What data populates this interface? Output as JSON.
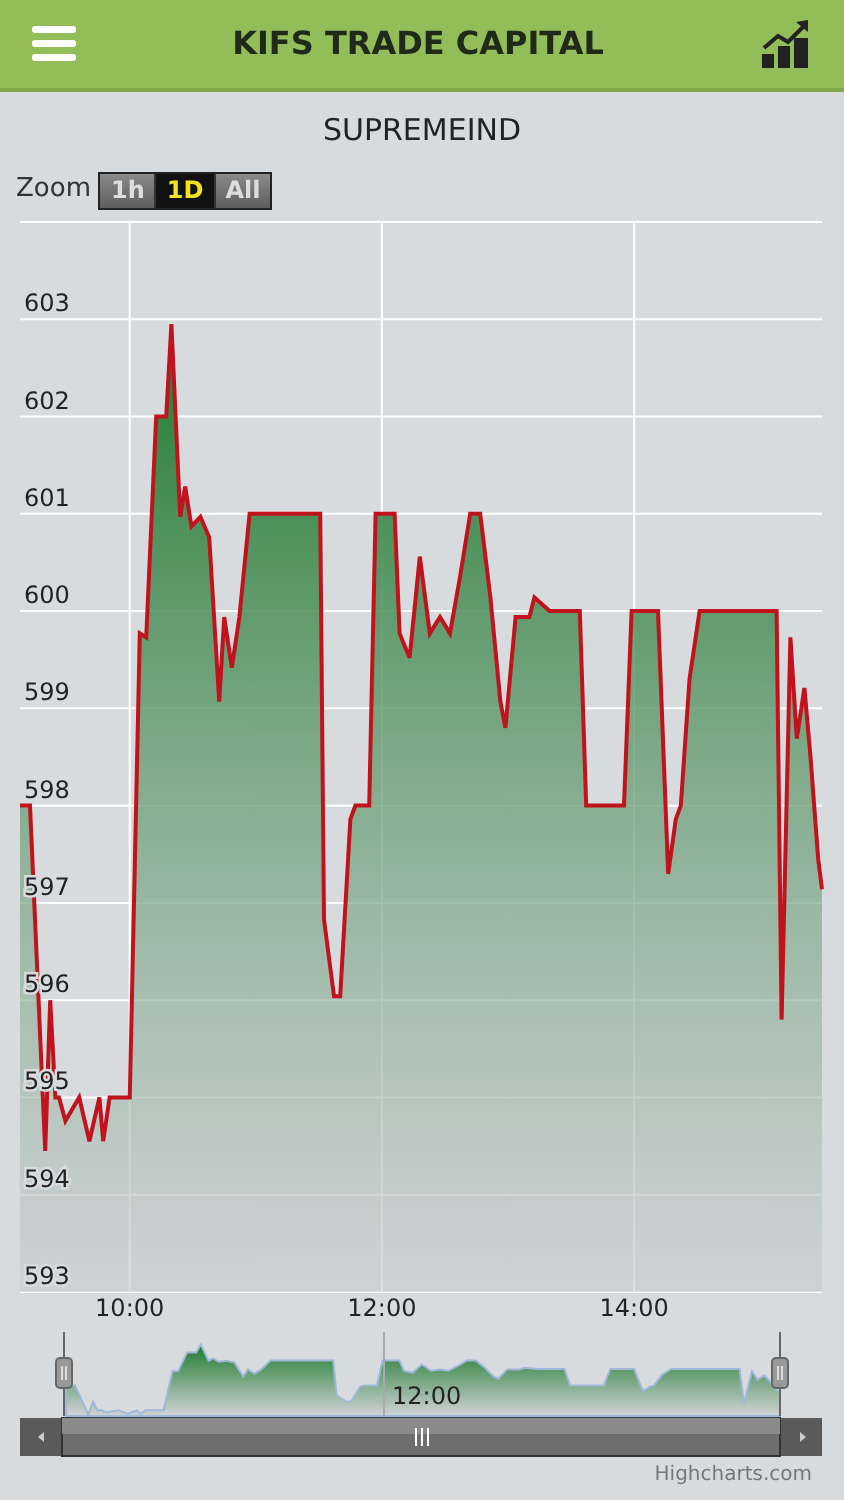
{
  "header": {
    "title": "KIFS TRADE CAPITAL"
  },
  "chart_title": "SUPREMEIND",
  "zoom": {
    "label": "Zoom",
    "buttons": [
      {
        "label": "1h",
        "selected": false
      },
      {
        "label": "1D",
        "selected": true
      },
      {
        "label": "All",
        "selected": false
      }
    ]
  },
  "chart_data": {
    "type": "area",
    "grid": true,
    "xlim": [
      9.13,
      15.49
    ],
    "ylim": [
      593,
      604
    ],
    "xticks": [
      {
        "value": 10,
        "label": "10:00"
      },
      {
        "value": 12,
        "label": "12:00"
      },
      {
        "value": 14,
        "label": "14:00"
      }
    ],
    "yticks": [
      593,
      594,
      595,
      596,
      597,
      598,
      599,
      600,
      601,
      602,
      603
    ],
    "x": [
      9.13,
      9.21,
      9.33,
      9.37,
      9.41,
      9.44,
      9.49,
      9.6,
      9.68,
      9.76,
      9.79,
      9.84,
      9.95,
      10.0,
      10.08,
      10.13,
      10.21,
      10.29,
      10.33,
      10.4,
      10.44,
      10.49,
      10.56,
      10.63,
      10.71,
      10.75,
      10.81,
      10.87,
      10.95,
      11.51,
      11.54,
      11.62,
      11.67,
      11.75,
      11.79,
      11.9,
      11.95,
      12.1,
      12.14,
      12.22,
      12.3,
      12.38,
      12.46,
      12.54,
      12.62,
      12.7,
      12.78,
      12.86,
      12.94,
      12.98,
      13.06,
      13.17,
      13.21,
      13.33,
      13.57,
      13.62,
      13.92,
      13.98,
      14.19,
      14.27,
      14.33,
      14.37,
      14.44,
      14.52,
      15.13,
      15.17,
      15.24,
      15.29,
      15.35,
      15.4,
      15.46,
      15.49
    ],
    "series": [
      {
        "color": "#c0131d",
        "values": [
          598.0,
          598.0,
          594.45,
          596.0,
          595.0,
          595.0,
          594.76,
          595.0,
          594.55,
          595.0,
          594.55,
          595.0,
          595.0,
          595.0,
          599.77,
          599.73,
          602.0,
          602.0,
          602.95,
          600.97,
          601.28,
          600.87,
          600.97,
          600.76,
          599.07,
          599.94,
          599.42,
          599.94,
          601.0,
          601.0,
          596.83,
          596.04,
          596.04,
          597.86,
          598.0,
          598.0,
          601.0,
          601.0,
          599.77,
          599.52,
          600.56,
          599.77,
          599.94,
          599.77,
          600.35,
          601.0,
          601.0,
          600.14,
          599.07,
          598.8,
          599.94,
          599.94,
          600.14,
          600.0,
          600.0,
          598.0,
          598.0,
          600.0,
          600.0,
          597.3,
          597.86,
          598.0,
          599.31,
          600.0,
          600.0,
          595.8,
          599.73,
          598.69,
          599.21,
          598.49,
          597.45,
          597.14
        ]
      }
    ]
  },
  "navigator": {
    "label": "12:00"
  },
  "credit": "Highcharts.com"
}
